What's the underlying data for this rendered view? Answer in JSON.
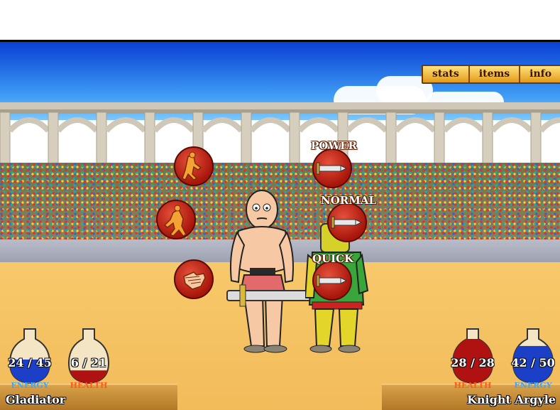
{
  "menu": {
    "stats": "stats",
    "items": "items",
    "info": "info"
  },
  "attacks": {
    "power_label": "POWER",
    "normal_label": "NORMAL",
    "quick_label": "QUICK"
  },
  "actions": [
    {
      "icon": "advance-icon"
    },
    {
      "icon": "retreat-icon"
    },
    {
      "icon": "rest-icon"
    }
  ],
  "player": {
    "name": "Gladiator",
    "energy_text": "24 / 45",
    "energy_label": "ENERGY",
    "health_text": "6 / 21",
    "health_label": "HEALTH",
    "energy_fraction": 0.533,
    "health_fraction": 0.286
  },
  "opponent": {
    "name": "Knight Argyle",
    "health_text": "28 / 28",
    "health_label": "HEALTH",
    "energy_text": "42 / 50",
    "energy_label": "ENERGY",
    "health_fraction": 1.0,
    "energy_fraction": 0.84
  },
  "colors": {
    "energy": "#1b3fc6",
    "health": "#b01212",
    "energy_label": "#39a6ff",
    "health_label": "#ff5a1a"
  }
}
